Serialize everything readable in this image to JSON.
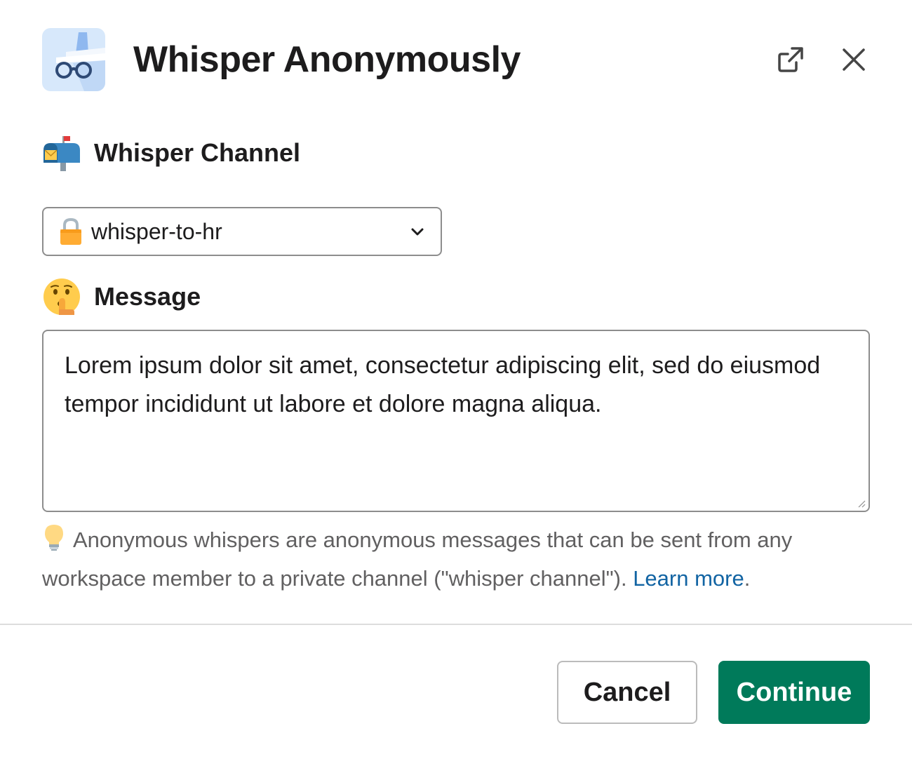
{
  "modal": {
    "title": "Whisper Anonymously",
    "app_icon": "incognito-glasses-icon",
    "actions": {
      "open_external_icon": "external-link-icon",
      "close_icon": "close-icon"
    }
  },
  "channel_section": {
    "label": "Whisper Channel",
    "emoji": "mailbox-icon",
    "select": {
      "value": "whisper-to-hr",
      "prefix_icon": "lock-icon",
      "dropdown_icon": "chevron-down-icon"
    }
  },
  "message_section": {
    "label": "Message",
    "emoji": "shushing-face-icon",
    "textarea": {
      "value": "Lorem ipsum dolor sit amet, consectetur adipiscing elit, sed do eiusmod tempor incididunt ut labore et dolore magna aliqua."
    }
  },
  "hint": {
    "icon": "lightbulb-icon",
    "text": "Anonymous whispers are anonymous messages that can be sent from any workspace member to a private channel (\"whisper channel\"). ",
    "link_text": "Learn more",
    "trailing": "."
  },
  "footer": {
    "cancel_label": "Cancel",
    "continue_label": "Continue"
  },
  "colors": {
    "primary": "#007a5a",
    "link": "#1264a3",
    "text": "#1d1c1d",
    "muted": "#616061",
    "border": "#8d8d8d"
  }
}
